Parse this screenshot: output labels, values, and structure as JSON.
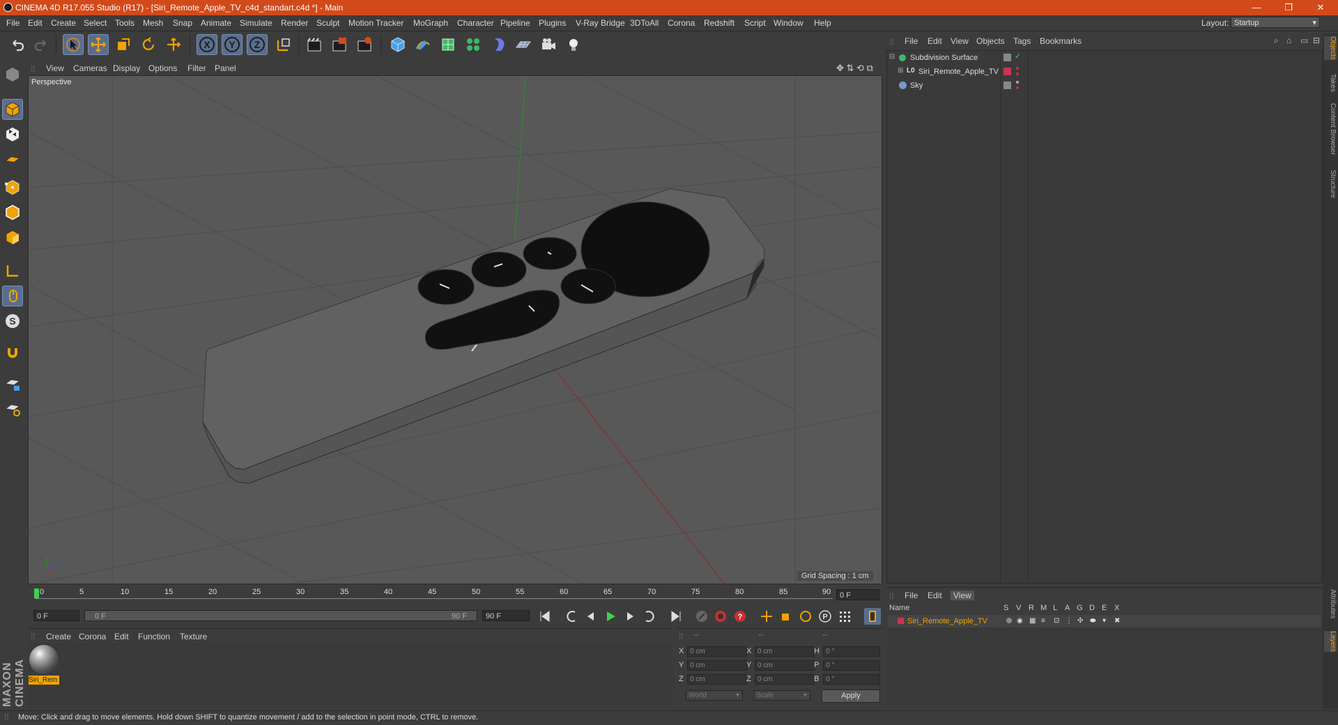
{
  "window": {
    "title": "CINEMA 4D R17.055 Studio (R17) - [Siri_Remote_Apple_TV_c4d_standart.c4d *] - Main",
    "minimize": "—",
    "maximize": "❐",
    "close": "✕"
  },
  "menubar": {
    "items": [
      "File",
      "Edit",
      "Create",
      "Select",
      "Tools",
      "Mesh",
      "Snap",
      "Animate",
      "Simulate",
      "Render",
      "Sculpt",
      "Motion Tracker",
      "MoGraph",
      "Character",
      "Pipeline",
      "Plugins",
      "V-Ray Bridge",
      "3DToAll",
      "Corona",
      "Redshift",
      "Script",
      "Window",
      "Help"
    ],
    "layout_label": "Layout:",
    "layout_value": "Startup"
  },
  "toolbar": {
    "icons": [
      "undo-icon",
      "redo-icon",
      "select-arrow-icon",
      "move-icon",
      "scale-icon",
      "rotate-icon",
      "live-selection-icon",
      "x-axis-icon",
      "y-axis-icon",
      "z-axis-icon",
      "coordinate-system-icon",
      "render-view-icon",
      "render-picture-viewer-icon",
      "edit-render-settings-icon",
      "cube-primitive-icon",
      "pen-spline-icon",
      "subdivision-icon",
      "cloner-icon",
      "deformer-icon",
      "floor-icon",
      "camera-icon",
      "light-icon"
    ]
  },
  "viewport": {
    "menu": [
      "View",
      "Cameras",
      "Display",
      "Options",
      "Filter",
      "Panel"
    ],
    "label": "Perspective",
    "grid_spacing": "Grid Spacing : 1 cm"
  },
  "timeline": {
    "ticks": [
      "0",
      "5",
      "10",
      "15",
      "20",
      "25",
      "30",
      "35",
      "40",
      "45",
      "50",
      "55",
      "60",
      "65",
      "70",
      "75",
      "80",
      "85",
      "90"
    ],
    "current_frame": "0 F",
    "start_field": "0 F",
    "range_start": "0 F",
    "range_end": "90 F",
    "end_field": "90 F"
  },
  "materials": {
    "menu": [
      "Create",
      "Corona",
      "Edit",
      "Function",
      "Texture"
    ],
    "items": [
      {
        "name": "Siri_Rem"
      }
    ]
  },
  "coordinates": {
    "headers": [
      "--",
      "--",
      "--"
    ],
    "rows": [
      {
        "a": "X",
        "av": "0 cm",
        "b": "X",
        "bv": "0 cm",
        "c": "H",
        "cv": "0 °"
      },
      {
        "a": "Y",
        "av": "0 cm",
        "b": "Y",
        "bv": "0 cm",
        "c": "P",
        "cv": "0 °"
      },
      {
        "a": "Z",
        "av": "0 cm",
        "b": "Z",
        "bv": "0 cm",
        "c": "B",
        "cv": "0 °"
      }
    ],
    "space": "World",
    "mode": "Scale",
    "apply": "Apply"
  },
  "object_manager": {
    "menu": [
      "File",
      "Edit",
      "View",
      "Objects",
      "Tags",
      "Bookmarks"
    ],
    "objects": [
      {
        "name": "Subdivision Surface",
        "color": "#5bc46a"
      },
      {
        "name": "Siri_Remote_Apple_TV",
        "color": "#cc3355"
      },
      {
        "name": "Sky",
        "color": "#7799cc"
      }
    ]
  },
  "layer_manager": {
    "menu": [
      "File",
      "Edit",
      "View"
    ],
    "columns": [
      "Name",
      "S",
      "V",
      "R",
      "M",
      "L",
      "A",
      "G",
      "D",
      "E",
      "X"
    ],
    "layers": [
      {
        "name": "Siri_Remote_Apple_TV",
        "color": "#cc3355"
      }
    ]
  },
  "right_tabs": [
    "Objects",
    "Takes",
    "Content Browser",
    "Structure",
    "Attributes",
    "Layers"
  ],
  "status": {
    "text": "Move: Click and drag to move elements. Hold down SHIFT to quantize movement / add to the selection in point mode, CTRL to remove."
  },
  "logo": "MAXON CINEMA 4D",
  "colors": {
    "titlebar": "#d24a1a",
    "accent": "#f0a400",
    "active_tool": "#5a6e8c"
  }
}
